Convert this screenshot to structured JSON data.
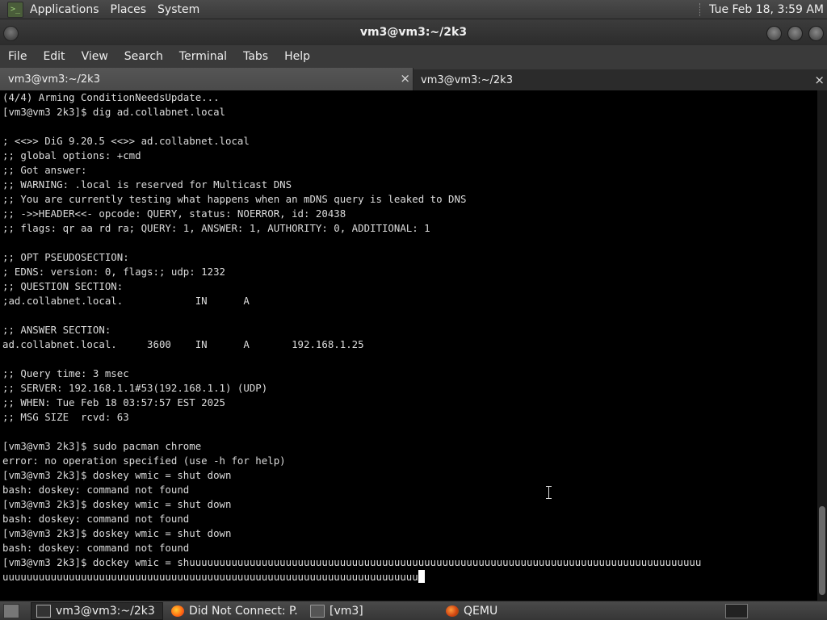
{
  "top_panel": {
    "menus": [
      "Applications",
      "Places",
      "System"
    ],
    "clock": "Tue Feb 18,  3:59 AM"
  },
  "window": {
    "title": "vm3@vm3:~/2k3"
  },
  "menubar": [
    "File",
    "Edit",
    "View",
    "Search",
    "Terminal",
    "Tabs",
    "Help"
  ],
  "tabs": [
    {
      "label": "vm3@vm3:~/2k3",
      "close": "×"
    },
    {
      "label": "vm3@vm3:~/2k3",
      "close": "×"
    }
  ],
  "terminal": {
    "lines": [
      "(4/4) Arming ConditionNeedsUpdate...",
      "[vm3@vm3 2k3]$ dig ad.collabnet.local",
      "",
      "; <<>> DiG 9.20.5 <<>> ad.collabnet.local",
      ";; global options: +cmd",
      ";; Got answer:",
      ";; WARNING: .local is reserved for Multicast DNS",
      ";; You are currently testing what happens when an mDNS query is leaked to DNS",
      ";; ->>HEADER<<- opcode: QUERY, status: NOERROR, id: 20438",
      ";; flags: qr aa rd ra; QUERY: 1, ANSWER: 1, AUTHORITY: 0, ADDITIONAL: 1",
      "",
      ";; OPT PSEUDOSECTION:",
      "; EDNS: version: 0, flags:; udp: 1232",
      ";; QUESTION SECTION:",
      ";ad.collabnet.local.            IN      A",
      "",
      ";; ANSWER SECTION:",
      "ad.collabnet.local.     3600    IN      A       192.168.1.25",
      "",
      ";; Query time: 3 msec",
      ";; SERVER: 192.168.1.1#53(192.168.1.1) (UDP)",
      ";; WHEN: Tue Feb 18 03:57:57 EST 2025",
      ";; MSG SIZE  rcvd: 63",
      "",
      "[vm3@vm3 2k3]$ sudo pacman chrome",
      "error: no operation specified (use -h for help)",
      "[vm3@vm3 2k3]$ doskey wmic = shut down",
      "bash: doskey: command not found",
      "[vm3@vm3 2k3]$ doskey wmic = shut down",
      "bash: doskey: command not found",
      "[vm3@vm3 2k3]$ doskey wmic = shut down",
      "bash: doskey: command not found",
      "[vm3@vm3 2k3]$ dockey wmic = shuuuuuuuuuuuuuuuuuuuuuuuuuuuuuuuuuuuuuuuuuuuuuuuuuuuuuuuuuuuuuuuuuuuuuuuuuuuuuuuuuuuuu"
    ],
    "last_line": "uuuuuuuuuuuuuuuuuuuuuuuuuuuuuuuuuuuuuuuuuuuuuuuuuuuuuuuuuuuuuuuuuuuuu"
  },
  "taskbar": {
    "tasks": [
      {
        "label": "vm3@vm3:~/2k3",
        "icon": "terminal-icon"
      },
      {
        "label": "Did Not Connect: P...",
        "icon": "firefox-icon"
      },
      {
        "label": "[vm3]",
        "icon": "folder-icon"
      },
      {
        "label": "QEMU",
        "icon": "qemu-icon"
      }
    ]
  }
}
